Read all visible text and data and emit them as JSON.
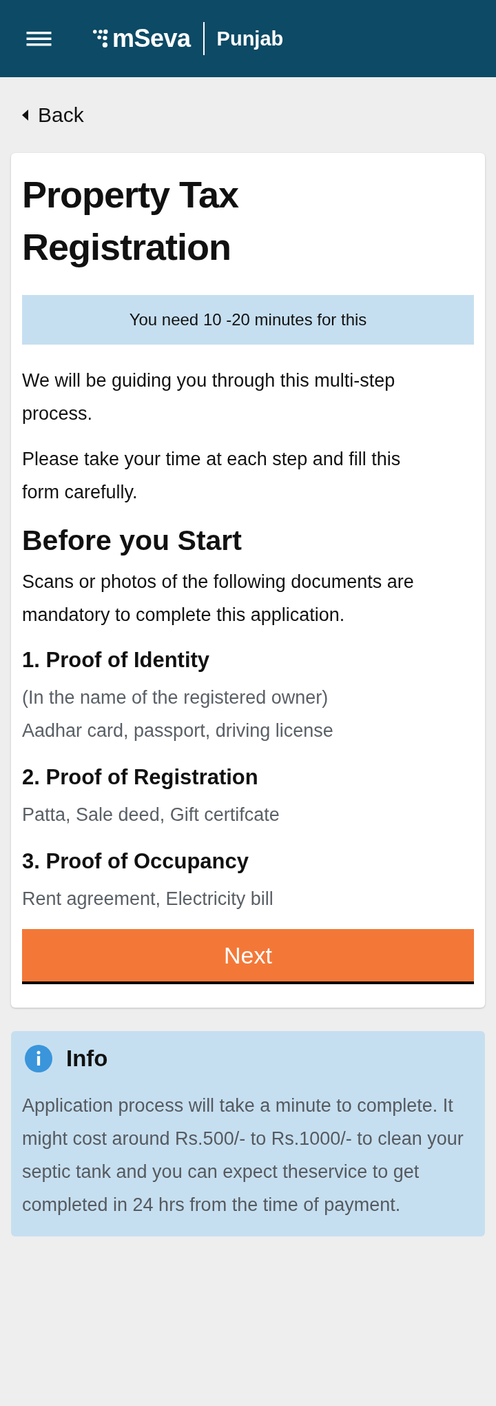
{
  "header": {
    "logo": "mSeva",
    "state": "Punjab"
  },
  "back": "Back",
  "card": {
    "title": "Property Tax Registration",
    "time_note": "You need 10 -20 minutes for this",
    "intro": [
      "We will be guiding you through this multi-step process.",
      "Please take your time at each step and fill this form carefully."
    ],
    "section_title": "Before you Start",
    "section_text": "Scans or photos of the following documents are mandatory to complete this application.",
    "documents": [
      {
        "title": "1. Proof of Identity",
        "lines": [
          "(In the name of the registered owner)",
          "Aadhar card, passport, driving license"
        ]
      },
      {
        "title": "2. Proof of Registration",
        "lines": [
          "Patta, Sale deed, Gift certifcate"
        ]
      },
      {
        "title": "3. Proof of Occupancy",
        "lines": [
          "Rent agreement, Electricity bill"
        ]
      }
    ],
    "button": "Next"
  },
  "info": {
    "title": "Info",
    "text": "Application process will take a minute to complete. It might cost around Rs.500/- to Rs.1000/- to clean your septic tank and you can expect theservice to get completed in 24 hrs from the time of payment."
  }
}
